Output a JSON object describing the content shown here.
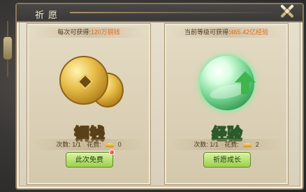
{
  "header": {
    "title": "祈愿"
  },
  "cards": [
    {
      "reward_prefix": "每次可获得:",
      "reward_value": "120万铜钱",
      "icon": "coin-stack-icon",
      "label": "铜钱",
      "count_text": "次数: 1/1",
      "cost_label": "花费:",
      "cost_value": "0",
      "button_label": "此次免费",
      "has_red_dot": true
    },
    {
      "reward_prefix": "当前等级可获得:",
      "reward_value": "465.42亿经验",
      "icon": "exp-orb-icon",
      "label": "经验",
      "count_text": "次数: 1/1",
      "cost_label": "花费:",
      "cost_value": "2",
      "button_label": "祈愿成长",
      "has_red_dot": false
    }
  ],
  "colors": {
    "accent_orange": "#e06a1c",
    "button_green": "#9ccf4e",
    "frame": "#8a7654"
  }
}
